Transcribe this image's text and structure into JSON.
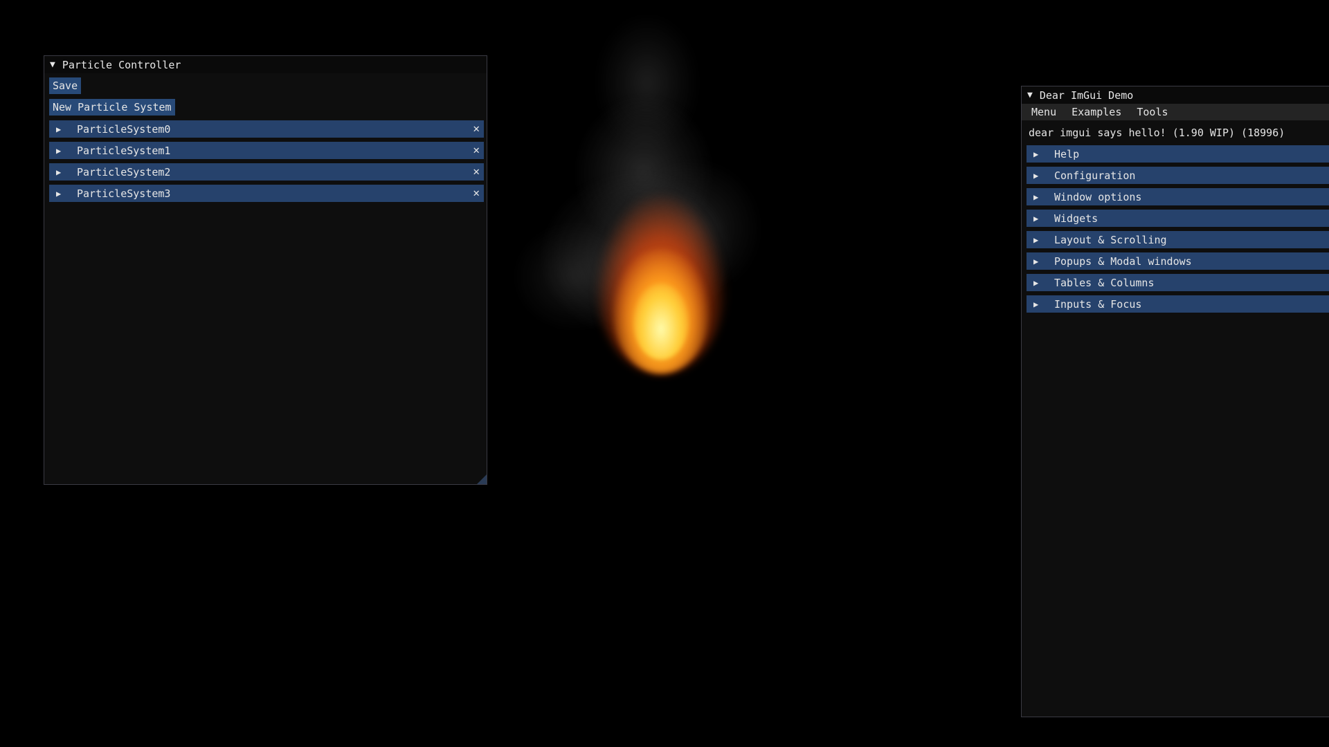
{
  "particle_controller": {
    "title": "Particle Controller",
    "save_label": "Save",
    "new_system_label": "New Particle System",
    "systems": [
      {
        "name": "ParticleSystem0"
      },
      {
        "name": "ParticleSystem1"
      },
      {
        "name": "ParticleSystem2"
      },
      {
        "name": "ParticleSystem3"
      }
    ],
    "close_glyph": "✕",
    "collapse_glyph": "▼",
    "expand_glyph": "▶"
  },
  "demo": {
    "title": "Dear ImGui Demo",
    "menu": [
      "Menu",
      "Examples",
      "Tools"
    ],
    "hello_text": "dear imgui says hello! (1.90 WIP) (18996)",
    "sections": [
      "Help",
      "Configuration",
      "Window options",
      "Widgets",
      "Layout & Scrolling",
      "Popups & Modal windows",
      "Tables & Columns",
      "Inputs & Focus"
    ]
  },
  "colors": {
    "background": "#000000",
    "window_bg": "#0f0f0f",
    "header": "#26426c",
    "button": "#284a78",
    "text": "#e6e6e6"
  }
}
